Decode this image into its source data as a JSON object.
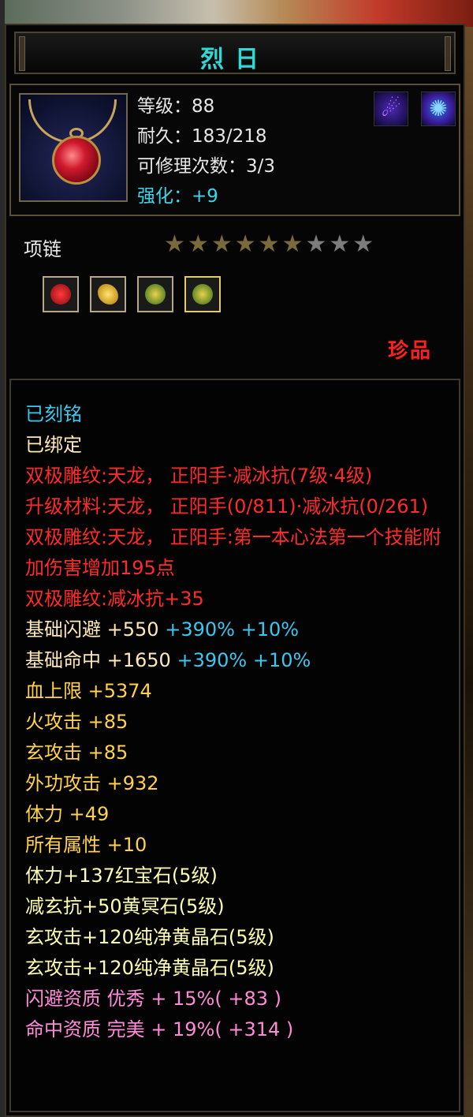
{
  "item": {
    "name": "烈日",
    "stats": {
      "level": "等级：88",
      "durability": "耐久：183/218",
      "repair": "可修理次数：3/3",
      "enhance": "强化：+9"
    },
    "type": "项链",
    "stars": {
      "filled": 6,
      "total": 9
    },
    "rarity": "珍品",
    "icons": [
      "necklace-icon",
      "signature-icon-1",
      "signature-icon-2",
      "ruby-socket-icon",
      "yellow-gem-socket-icon",
      "green-gem-socket-icon",
      "green-gem-socket-icon"
    ]
  },
  "attributes": {
    "engraved": "已刻铭",
    "bound": "已绑定",
    "carve1": "双极雕纹:天龙， 正阳手·减冰抗(7级·4级)",
    "upgrade": "升级材料:天龙， 正阳手(0/811)·减冰抗(0/261)",
    "carve2": "双极雕纹:天龙， 正阳手:第一本心法第一个技能附加伤害增加195点",
    "carve3": "双极雕纹:减冰抗+35",
    "dodge": {
      "label": "基础闪避",
      "base": "+550",
      "pct1": "+390%",
      "pct2": "+10%"
    },
    "hit": {
      "label": "基础命中",
      "base": "+1650",
      "pct1": "+390%",
      "pct2": "+10%"
    },
    "hp": "血上限 +5374",
    "fire": "火攻击 +85",
    "xuan": "玄攻击 +85",
    "outer": "外功攻击 +932",
    "stamina": "体力 +49",
    "all": "所有属性 +10",
    "gem1": "体力+137红宝石(5级)",
    "gem2": "减玄抗+50黄冥石(5级)",
    "gem3": "玄攻击+120纯净黄晶石(5级)",
    "gem4": "玄攻击+120纯净黄晶石(5级)",
    "q_dodge": "闪避资质 优秀 + 15%( +83 )",
    "q_hit": "命中资质 完美 + 19%( +314 )"
  },
  "colors": {
    "title": "#2fd9d4",
    "rarity": "#ff2020",
    "enhance": "#39d7ef",
    "carve": "#ff2a2a",
    "base_attr": "#ffd24a",
    "gem": "#ffffb0",
    "quality": "#ff8ad8"
  }
}
